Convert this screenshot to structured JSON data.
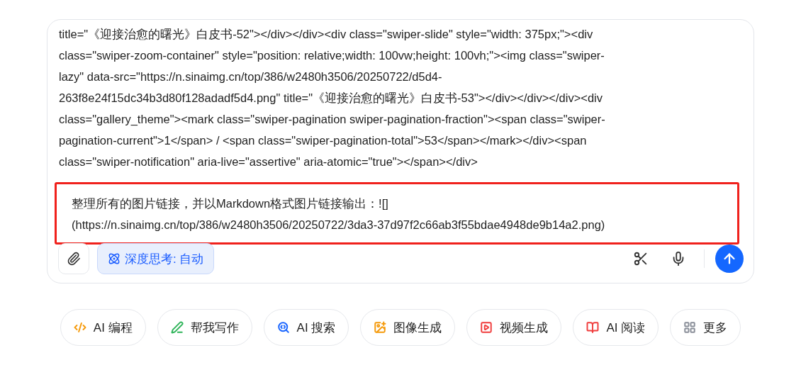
{
  "editor": {
    "lines": [
      "title=\"《迎接治愈的曙光》白皮书-52\"></div></div><div class=\"swiper-slide\" style=\"width: 375px;\"><div",
      "class=\"swiper-zoom-container\" style=\"position: relative;width: 100vw;height: 100vh;\"><img class=\"swiper-",
      "lazy\" data-src=\"https://n.sinaimg.cn/top/386/w2480h3506/20250722/d5d4-",
      "263f8e24f15dc34b3d80f128adadf5d4.png\" title=\"《迎接治愈的曙光》白皮书-53\"></div></div></div><div",
      "class=\"gallery_theme\"><mark class=\"swiper-pagination swiper-pagination-fraction\"><span class=\"swiper-",
      "pagination-current\">1</span> / <span class=\"swiper-pagination-total\">53</span></mark></div><span",
      "class=\"swiper-notification\" aria-live=\"assertive\" aria-atomic=\"true\"></span></div>"
    ],
    "prompt_lines": [
      "整理所有的图片链接，并以Markdown格式图片链接输出：![]",
      "(https://n.sinaimg.cn/top/386/w2480h3506/20250722/3da3-37d97f2c66ab3f55bdae4948de9b14a2.png)"
    ],
    "prompt_highlighted": true,
    "deep_think": {
      "label": "深度思考: 自动",
      "selected": true
    }
  },
  "shortcuts": [
    {
      "kind": "code",
      "label": "AI 编程",
      "color": "#f59a0b"
    },
    {
      "kind": "write",
      "label": "帮我写作",
      "color": "#2fb45a"
    },
    {
      "kind": "search",
      "label": "AI 搜索",
      "color": "#1a66ff"
    },
    {
      "kind": "image",
      "label": "图像生成",
      "color": "#f59a0b"
    },
    {
      "kind": "video",
      "label": "视频生成",
      "color": "#f03e3e"
    },
    {
      "kind": "read",
      "label": "AI 阅读",
      "color": "#f03e3e"
    },
    {
      "kind": "more",
      "label": "更多",
      "color": "#8a8f99"
    }
  ]
}
